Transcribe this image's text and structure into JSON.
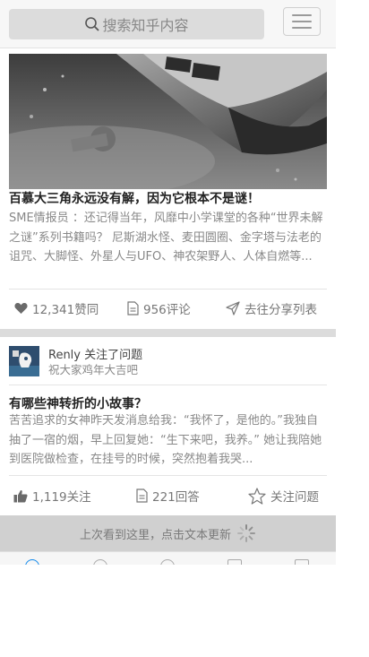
{
  "search": {
    "placeholder": "搜索知乎内容",
    "icon": "search-icon"
  },
  "header": {
    "menu_icon": "hamburger-icon"
  },
  "cards": [
    {
      "title": "百慕大三角永远没有解，因为它根本不是谜！",
      "excerpt": "SME情报员 ：还记得当年，风靡中小学课堂的各种“世界未解之谜”系列书籍吗？ 尼斯湖水怪、麦田圆圈、金字塔与法老的诅咒、大脚怪、外星人与UFO、神农架野人、人体自燃等...",
      "actions": {
        "likes": "12,341赞同",
        "comments": "956评论",
        "share": "去往分享列表"
      }
    },
    {
      "feed_user_line": "Renly 关注了问题",
      "feed_sub_line": "祝大家鸡年大吉吧",
      "title": "有哪些神转折的小故事？",
      "excerpt": "苦苦追求的女神昨天发消息给我：“我怀了，是他的。”我独自抽了一宿的烟，早上回复她：“生下来吧，我养。” 她让我陪她到医院做检查，在挂号的时候，突然抱着我哭...",
      "actions": {
        "follows": "1,119关注",
        "answers": "221回答",
        "follow_question": "关注问题"
      }
    }
  ],
  "refresh_bar": {
    "label": "上次看到这里，点击文本更新"
  },
  "colors": {
    "accent": "#0f88eb",
    "muted_text": "#888888",
    "title_text": "#222222"
  }
}
